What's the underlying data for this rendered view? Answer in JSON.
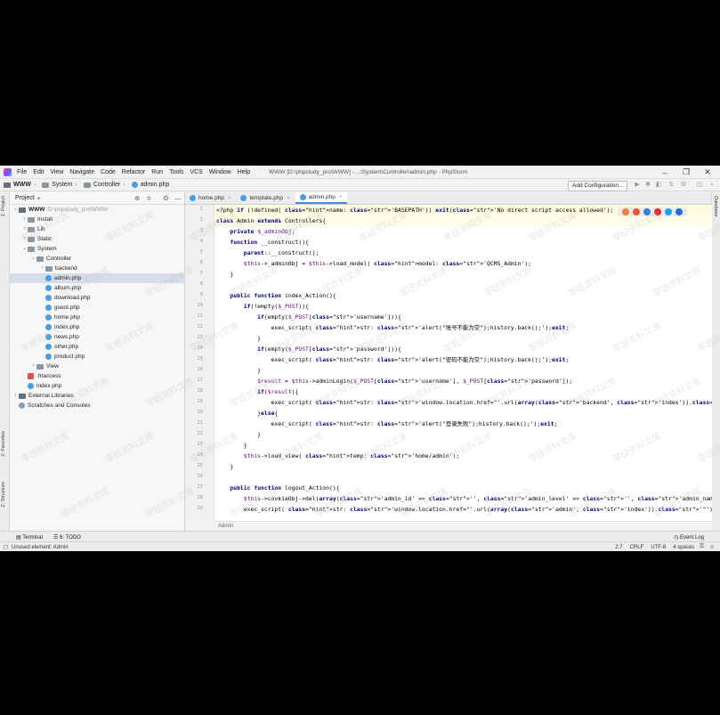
{
  "window": {
    "title": "WWW [D:\\phpstudy_pro\\WWW] - ...\\System\\Controller\\admin.php - PhpStorm",
    "controls": {
      "minimize": "–",
      "maximize": "❐",
      "close": "✕"
    }
  },
  "menu": [
    "File",
    "Edit",
    "View",
    "Navigate",
    "Code",
    "Refactor",
    "Run",
    "Tools",
    "VCS",
    "Window",
    "Help"
  ],
  "breadcrumbs": [
    "WWW",
    "System",
    "Controller",
    "admin.php"
  ],
  "toolbar": {
    "add_configuration": "Add Configuration..."
  },
  "project_panel": {
    "title": "Project",
    "root": {
      "name": "WWW",
      "path": "D:\\phpstudy_pro\\WWW"
    },
    "items": [
      {
        "label": "Install",
        "kind": "folder",
        "indent": 1,
        "arrow": "›"
      },
      {
        "label": "Lib",
        "kind": "folder",
        "indent": 1,
        "arrow": "›"
      },
      {
        "label": "Static",
        "kind": "folder",
        "indent": 1,
        "arrow": "›"
      },
      {
        "label": "System",
        "kind": "folder",
        "indent": 1,
        "arrow": "⌄"
      },
      {
        "label": "Controller",
        "kind": "folder",
        "indent": 2,
        "arrow": "⌄"
      },
      {
        "label": "backend",
        "kind": "folder",
        "indent": 3,
        "arrow": "›"
      },
      {
        "label": "admin.php",
        "kind": "php",
        "indent": 3,
        "selected": true
      },
      {
        "label": "album.php",
        "kind": "php",
        "indent": 3
      },
      {
        "label": "download.php",
        "kind": "php",
        "indent": 3
      },
      {
        "label": "guest.php",
        "kind": "php",
        "indent": 3
      },
      {
        "label": "home.php",
        "kind": "php",
        "indent": 3
      },
      {
        "label": "index.php",
        "kind": "php",
        "indent": 3
      },
      {
        "label": "news.php",
        "kind": "php",
        "indent": 3
      },
      {
        "label": "other.php",
        "kind": "php",
        "indent": 3
      },
      {
        "label": "product.php",
        "kind": "php",
        "indent": 3
      },
      {
        "label": "View",
        "kind": "folder",
        "indent": 2,
        "arrow": "›"
      },
      {
        "label": ".htaccess",
        "kind": "file",
        "indent": 1
      },
      {
        "label": "index.php",
        "kind": "php",
        "indent": 1
      },
      {
        "label": "External Libraries",
        "kind": "lib",
        "indent": 0,
        "arrow": "›"
      },
      {
        "label": "Scratches and Consoles",
        "kind": "scratch",
        "indent": 0
      }
    ]
  },
  "tabs": [
    {
      "label": "home.php",
      "active": false
    },
    {
      "label": "template.php",
      "active": false
    },
    {
      "label": "admin.php",
      "active": true
    }
  ],
  "editor": {
    "breadcrumb": "Admin",
    "lines": [
      "<?php if (!defined( name: 'BASEPATH')) exit('No direct script access allowed');",
      "class Admin extends Controllers{",
      "    private $_adminObj;",
      "    function __construct(){",
      "        parent::__construct();",
      "        $this->_adminObj = $this->load_model( model: 'QCMS_Admin');",
      "    }",
      "",
      "    public function index_Action(){",
      "        if(!empty($_POST)){",
      "            if(empty($_POST['username'])){",
      "                exec_script( str: 'alert(\"账号不能为空\");history.back();');exit;",
      "            }",
      "            if(empty($_POST['password'])){",
      "                exec_script( str: 'alert(\"密码不能为空\");history.back();');exit;",
      "            }",
      "            $result = $this->adminLogin($_POST['username'], $_POST['password']);",
      "            if($result){",
      "                exec_script( str: 'window.location.href=\"'.url(array('backend', 'index')).'\"');exit;",
      "            }else{",
      "                exec_script( str: 'alert(\"登录失败\");history.back();');exit;",
      "            }",
      "        }",
      "        $this->load_view( temp: 'home/admin');",
      "    }",
      "",
      "    public function logout_Action(){",
      "        $this->cookieObj->del(array('admin_id' => '', 'admin_level' => '', 'admin_name' => '', 'admin_secret' => ''));",
      "        exec_script( str: 'window.location.href=\"'.url(array('admin', 'index')).'\"');exit;"
    ],
    "line_numbers": [
      "1",
      "2",
      "3",
      "4",
      "5",
      "6",
      "7",
      "8",
      "9",
      "10",
      "11",
      "12",
      "13",
      "14",
      "15",
      "16",
      "17",
      "18",
      "19",
      "20",
      "21",
      "22",
      "23",
      "24",
      "25",
      "26",
      "27",
      "28",
      "29"
    ]
  },
  "side_tabs": {
    "left_top": "1: Project",
    "left_mid": "2: Favorites",
    "left_bottom": "Z: Structure",
    "right": "Database"
  },
  "bottom_tools": {
    "terminal": "Terminal",
    "todo": "6: TODO",
    "event_log": "Event Log"
  },
  "status": {
    "message": "Unused element: Admin",
    "position": "2:7",
    "line_sep": "CRLF",
    "encoding": "UTF-8",
    "indent": "4 spaces"
  },
  "watermark": "零妞资料文库",
  "colors": {
    "keyword": "#000080",
    "string": "#067d17",
    "variable": "#660e7a",
    "accent": "#4a88d9"
  }
}
